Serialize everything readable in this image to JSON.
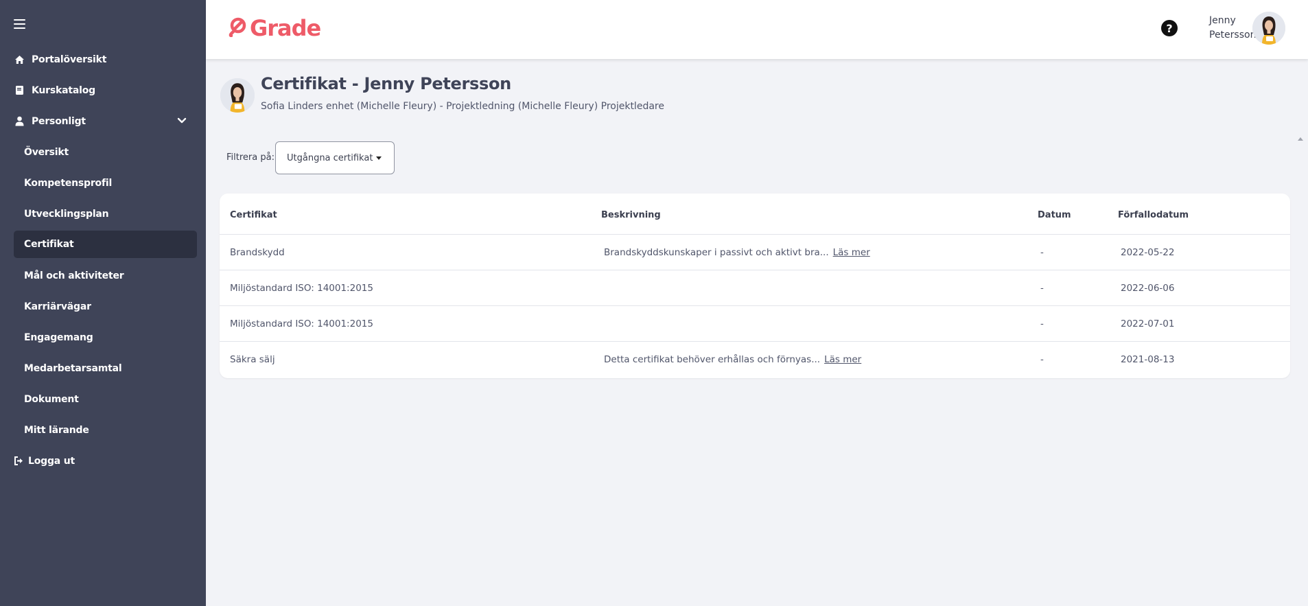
{
  "sidebar": {
    "items": [
      {
        "label": "Portalöversikt",
        "icon": "home-icon"
      },
      {
        "label": "Kurskatalog",
        "icon": "book-icon"
      },
      {
        "label": "Personligt",
        "icon": "user-icon"
      }
    ],
    "sub_items": [
      {
        "label": "Översikt"
      },
      {
        "label": "Kompetensprofil"
      },
      {
        "label": "Utvecklingsplan"
      },
      {
        "label": "Certifikat",
        "active": true
      },
      {
        "label": "Mål och aktiviteter"
      },
      {
        "label": "Karriärvägar"
      },
      {
        "label": "Engagemang"
      },
      {
        "label": "Medarbetarsamtal"
      },
      {
        "label": "Dokument"
      },
      {
        "label": "Mitt lärande"
      }
    ],
    "logout": {
      "label": "Logga ut",
      "icon": "logout-icon"
    }
  },
  "header": {
    "logo_text": "Grade",
    "user_first": "Jenny",
    "user_last": "Petersson",
    "help_glyph": "?"
  },
  "page": {
    "title": "Certifikat - Jenny Petersson",
    "subtitle": "Sofia Linders enhet (Michelle Fleury) - Projektledning (Michelle Fleury) Projektledare"
  },
  "filter": {
    "label": "Filtrera på:",
    "selected": "Utgångna certifikat"
  },
  "table": {
    "headers": {
      "certificate": "Certifikat",
      "description": "Beskrivning",
      "date": "Datum",
      "expiry": "Förfallodatum"
    },
    "rows": [
      {
        "certificate": "Brandskydd",
        "description": "Brandskyddskunskaper i passivt och aktivt bra...",
        "read_more": "Läs mer",
        "date": "-",
        "expiry": "2022-05-22"
      },
      {
        "certificate": "Miljöstandard ISO: 14001:2015",
        "description": "",
        "read_more": "",
        "date": "-",
        "expiry": "2022-06-06"
      },
      {
        "certificate": "Miljöstandard ISO: 14001:2015",
        "description": "",
        "read_more": "",
        "date": "-",
        "expiry": "2022-07-01"
      },
      {
        "certificate": "Säkra sälj",
        "description": "Detta certifikat behöver erhållas och förnyas...",
        "read_more": "Läs mer",
        "date": "-",
        "expiry": "2021-08-13"
      }
    ]
  },
  "colors": {
    "sidebar": "#3f4458",
    "sidebar_active": "#2c3040",
    "brand": "#ee5b68",
    "background": "#f2f3f7"
  }
}
